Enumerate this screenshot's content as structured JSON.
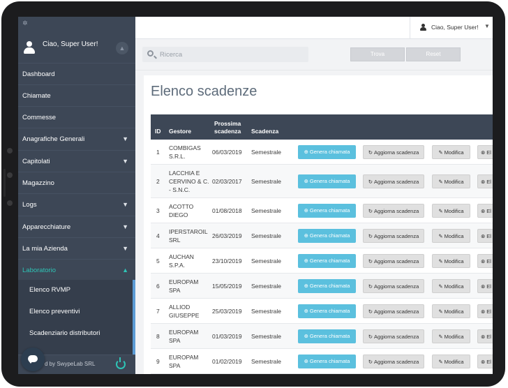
{
  "sidebar": {
    "greeting": "Ciao, Super User!",
    "nav": [
      {
        "label": "Dashboard",
        "chevron": false
      },
      {
        "label": "Chiamate",
        "chevron": false
      },
      {
        "label": "Commesse",
        "chevron": false
      },
      {
        "label": "Anagrafiche Generali",
        "chevron": true
      },
      {
        "label": "Capitolati",
        "chevron": true
      },
      {
        "label": "Magazzino",
        "chevron": false
      },
      {
        "label": "Logs",
        "chevron": true
      },
      {
        "label": "Apparecchiature",
        "chevron": true
      },
      {
        "label": "La mia Azienda",
        "chevron": true
      },
      {
        "label": "Laboratorio",
        "chevron": true,
        "active": true
      }
    ],
    "sub_items": [
      "Elenco RVMP",
      "Elenco preventivi",
      "Scadenziario distributori"
    ],
    "footer": "d by SwypeLab SRL"
  },
  "topbar": {
    "user_label": "Ciao, Super User!"
  },
  "search": {
    "placeholder": "Ricerca",
    "find_label": "Trova",
    "reset_label": "Reset"
  },
  "main": {
    "title": "Elenco scadenze",
    "columns": [
      "ID",
      "Gestore",
      "Prossima scadenza",
      "Scadenza"
    ],
    "actions": {
      "generate": "Genera chiamata",
      "update": "Aggiorna scadenza",
      "edit": "Modifica",
      "delete": "El"
    },
    "rows": [
      {
        "id": "1",
        "gestore": "COMBIGAS S.R.L.",
        "prossima": "06/03/2019",
        "scadenza": "Semestrale"
      },
      {
        "id": "2",
        "gestore": "LACCHIA E CERVINO & C. - S.N.C.",
        "prossima": "02/03/2017",
        "scadenza": "Semestrale"
      },
      {
        "id": "3",
        "gestore": "ACOTTO DIEGO",
        "prossima": "01/08/2018",
        "scadenza": "Semestrale"
      },
      {
        "id": "4",
        "gestore": "IPERSTAROIL SRL",
        "prossima": "26/03/2019",
        "scadenza": "Semestrale"
      },
      {
        "id": "5",
        "gestore": "AUCHAN S.P.A.",
        "prossima": "23/10/2019",
        "scadenza": "Semestrale"
      },
      {
        "id": "6",
        "gestore": "EUROPAM SPA",
        "prossima": "15/05/2019",
        "scadenza": "Semestrale"
      },
      {
        "id": "7",
        "gestore": "ALLIOD GIUSEPPE",
        "prossima": "25/03/2019",
        "scadenza": "Semestrale"
      },
      {
        "id": "8",
        "gestore": "EUROPAM SPA",
        "prossima": "01/03/2019",
        "scadenza": "Semestrale"
      },
      {
        "id": "9",
        "gestore": "EUROPAM SPA",
        "prossima": "01/02/2019",
        "scadenza": "Semestrale"
      }
    ]
  },
  "colors": {
    "sidebar": "#3d4756",
    "accent": "#2ec4b6",
    "primary_button": "#5bc0de",
    "table_header": "#3d4756"
  },
  "icons": [
    "user-icon",
    "bell-icon",
    "chevron-down-icon",
    "chevron-up-icon",
    "search-icon",
    "plus-circle-icon",
    "refresh-icon",
    "edit-icon",
    "times-circle-icon",
    "power-icon",
    "chat-icon"
  ]
}
